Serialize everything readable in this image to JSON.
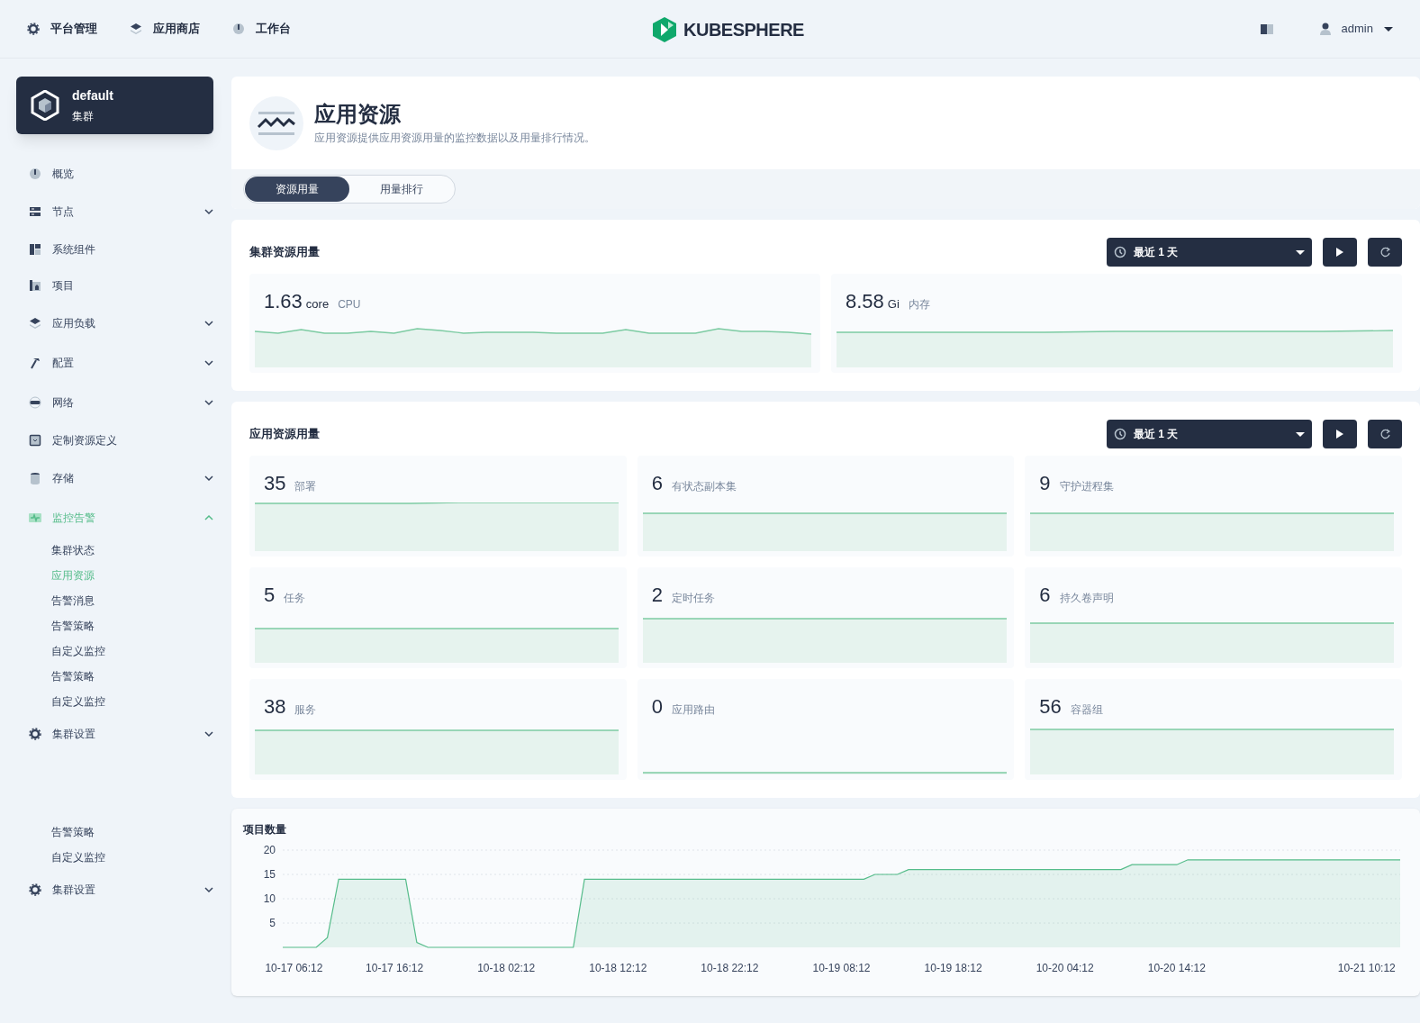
{
  "top_nav": [
    {
      "label": "平台管理"
    },
    {
      "label": "应用商店"
    },
    {
      "label": "工作台"
    }
  ],
  "logo": {
    "text": "KUBESPHERE"
  },
  "user": {
    "name": "admin"
  },
  "cluster_card": {
    "name": "default",
    "subtitle": "集群"
  },
  "sidebar": {
    "items": [
      {
        "kind": "link",
        "label": "概览",
        "selected": false
      },
      {
        "kind": "group",
        "label": "节点",
        "selected": false,
        "expanded": false
      },
      {
        "kind": "link",
        "label": "系统组件",
        "selected": false
      },
      {
        "kind": "link",
        "label": "项目",
        "selected": false
      },
      {
        "kind": "group",
        "label": "应用负载",
        "selected": false,
        "expanded": false
      },
      {
        "kind": "group",
        "label": "配置",
        "selected": false,
        "expanded": false
      },
      {
        "kind": "group",
        "label": "网络",
        "selected": false,
        "expanded": false
      },
      {
        "kind": "link",
        "label": "定制资源定义",
        "selected": false
      },
      {
        "kind": "group",
        "label": "存储",
        "selected": false,
        "expanded": false
      },
      {
        "kind": "group",
        "label": "监控告警",
        "selected": true,
        "expanded": true
      },
      {
        "kind": "sub",
        "label": "集群状态",
        "selected": false
      },
      {
        "kind": "sub",
        "label": "应用资源",
        "selected": true
      },
      {
        "kind": "sub",
        "label": "告警消息",
        "selected": false
      },
      {
        "kind": "sub",
        "label": "告警策略",
        "selected": false
      },
      {
        "kind": "sub",
        "label": "自定义监控",
        "selected": false
      },
      {
        "kind": "sub",
        "label": "告警策略",
        "selected": false
      },
      {
        "kind": "sub",
        "label": "自定义监控",
        "selected": false
      },
      {
        "kind": "group",
        "label": "集群设置",
        "selected": false,
        "expanded": false
      },
      {
        "kind": "sub",
        "label": "告警策略",
        "selected": false
      },
      {
        "kind": "sub",
        "label": "自定义监控",
        "selected": false
      },
      {
        "kind": "group",
        "label": "集群设置",
        "selected": false,
        "expanded": false
      }
    ]
  },
  "page_header": {
    "title": "应用资源",
    "description": "应用资源提供应用资源用量的监控数据以及用量排行情况。"
  },
  "tabs": [
    {
      "label": "资源用量",
      "selected": true
    },
    {
      "label": "用量排行",
      "selected": false
    }
  ],
  "cluster_usage": {
    "title": "集群资源用量",
    "time_range": "最近 1 天",
    "metrics": [
      {
        "value": "1.63",
        "unit": "core",
        "label": "CPU"
      },
      {
        "value": "8.58",
        "unit": "Gi",
        "label": "内存"
      }
    ]
  },
  "app_usage": {
    "title": "应用资源用量",
    "time_range": "最近 1 天",
    "metrics": [
      {
        "value": "35",
        "label": "部署"
      },
      {
        "value": "6",
        "label": "有状态副本集"
      },
      {
        "value": "9",
        "label": "守护进程集"
      },
      {
        "value": "5",
        "label": "任务"
      },
      {
        "value": "2",
        "label": "定时任务"
      },
      {
        "value": "6",
        "label": "持久卷声明"
      },
      {
        "value": "38",
        "label": "服务"
      },
      {
        "value": "0",
        "label": "应用路由"
      },
      {
        "value": "56",
        "label": "容器组"
      }
    ]
  },
  "project_count": {
    "title": "项目数量",
    "chart_data": {
      "type": "area",
      "categories": [
        null,
        "10-17 06:12",
        null,
        null,
        null,
        null,
        null,
        null,
        null,
        null,
        "10-17 16:12",
        null,
        null,
        null,
        null,
        null,
        null,
        null,
        null,
        null,
        "10-18 02:12",
        null,
        null,
        null,
        null,
        null,
        null,
        null,
        null,
        null,
        "10-18 12:12",
        null,
        null,
        null,
        null,
        null,
        null,
        null,
        null,
        null,
        "10-18 22:12",
        null,
        null,
        null,
        null,
        null,
        null,
        null,
        null,
        null,
        "10-19 08:12",
        null,
        null,
        null,
        null,
        null,
        null,
        null,
        null,
        null,
        "10-19 18:12",
        null,
        null,
        null,
        null,
        null,
        null,
        null,
        null,
        null,
        "10-20 04:12",
        null,
        null,
        null,
        null,
        null,
        null,
        null,
        null,
        null,
        "10-20 14:12",
        null,
        null,
        null,
        null,
        null,
        null,
        null,
        null,
        null,
        null,
        null,
        null,
        null,
        null,
        null,
        null,
        "10-21 10:12",
        null,
        null,
        null
      ],
      "series": [
        {
          "color": "#55bc8a",
          "values": [
            0,
            0,
            0,
            0,
            2,
            14,
            14,
            14,
            14,
            14,
            14,
            14,
            1,
            0,
            0,
            0,
            0,
            0,
            0,
            0,
            0,
            0,
            0,
            0,
            0,
            0,
            0,
            14,
            14,
            14,
            14,
            14,
            14,
            14,
            14,
            14,
            14,
            14,
            14,
            14,
            14,
            14,
            14,
            14,
            14,
            14,
            14,
            14,
            14,
            14,
            14,
            14,
            14,
            15,
            15,
            15,
            16,
            16,
            16,
            16,
            16,
            16,
            16,
            16,
            16,
            16,
            16,
            16,
            16,
            16,
            16,
            16,
            16,
            16,
            16,
            16,
            17,
            17,
            17,
            17,
            17,
            18,
            18,
            18,
            18,
            18,
            18,
            18,
            18,
            18,
            18,
            18,
            18,
            18,
            18,
            18,
            18,
            18,
            18,
            18,
            18
          ]
        }
      ],
      "ylim": [
        0,
        20
      ],
      "yticks": [
        5,
        10,
        15,
        20
      ],
      "grid": true
    }
  }
}
